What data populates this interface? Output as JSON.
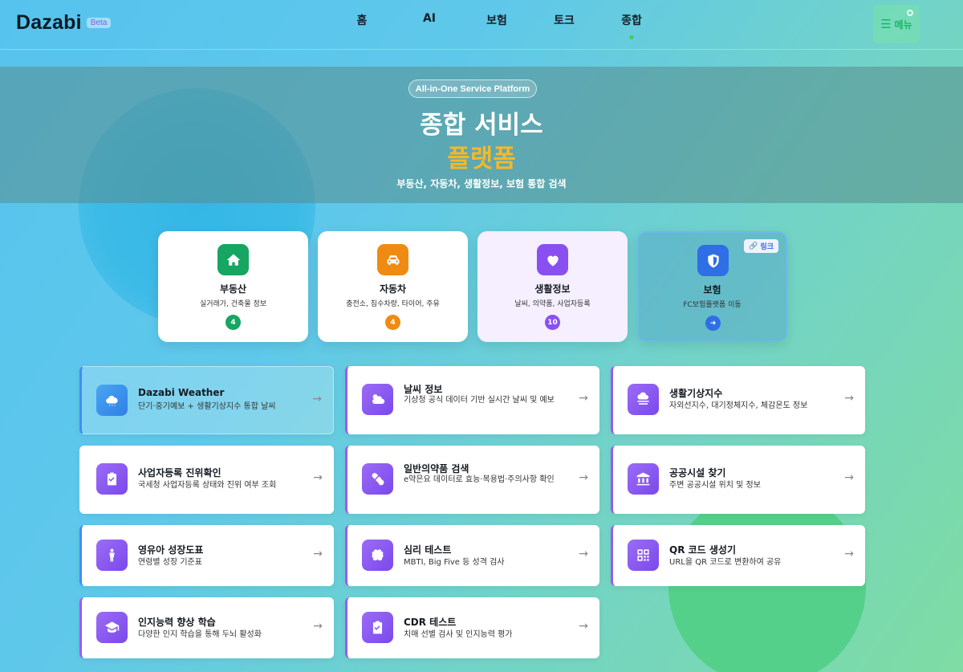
{
  "brand": {
    "name": "Dazabi",
    "badge": "Beta"
  },
  "nav": [
    {
      "label": "홈"
    },
    {
      "label": "AI"
    },
    {
      "label": "보험"
    },
    {
      "label": "토크"
    },
    {
      "label": "종합"
    }
  ],
  "menu": {
    "label": "메뉴"
  },
  "hero": {
    "pill": "All-in-One Service Platform",
    "title": "종합 서비스",
    "subtitle": "플랫폼",
    "description": "부동산, 자동차, 생활정보, 보험 통합 검색"
  },
  "categories": [
    {
      "title": "부동산",
      "desc": "실거래가, 건축물 정보",
      "count": "4",
      "color": "#17a562"
    },
    {
      "title": "자동차",
      "desc": "충전소, 침수차량, 타이어, 주유",
      "count": "4",
      "color": "#ef8b12"
    },
    {
      "title": "생활정보",
      "desc": "날씨, 의약품, 사업자등록",
      "count": "10",
      "color": "#8a4ff0"
    },
    {
      "title": "보험",
      "desc": "FC보험플랫폼 이동",
      "link": "링크",
      "color": "#2f6fe6"
    }
  ],
  "services": [
    {
      "title": "Dazabi Weather",
      "desc": "단기·중기예보 + 생활기상지수 통합 날씨"
    },
    {
      "title": "날씨 정보",
      "desc": "기상청 공식 데이터 기반 실시간 날씨 및 예보"
    },
    {
      "title": "생활기상지수",
      "desc": "자외선지수, 대기정체지수, 체감온도 정보"
    },
    {
      "title": "사업자등록 진위확인",
      "desc": "국세청 사업자등록 상태와 진위 여부 조회"
    },
    {
      "title": "일반의약품 검색",
      "desc": "e약은요 데이터로 효능·복용법·주의사항 확인"
    },
    {
      "title": "공공시설 찾기",
      "desc": "주변 공공시설 위치 및 정보"
    },
    {
      "title": "영유아 성장도표",
      "desc": "연령별 성장 기준표"
    },
    {
      "title": "심리 테스트",
      "desc": "MBTI, Big Five 등 성격 검사"
    },
    {
      "title": "QR 코드 생성기",
      "desc": "URL을 QR 코드로 변환하여 공유"
    },
    {
      "title": "인지능력 향상 학습",
      "desc": "다양한 인지 학습을 통해 두뇌 활성화"
    },
    {
      "title": "CDR 테스트",
      "desc": "치매 선별 검사 및 인지능력 평가"
    }
  ]
}
